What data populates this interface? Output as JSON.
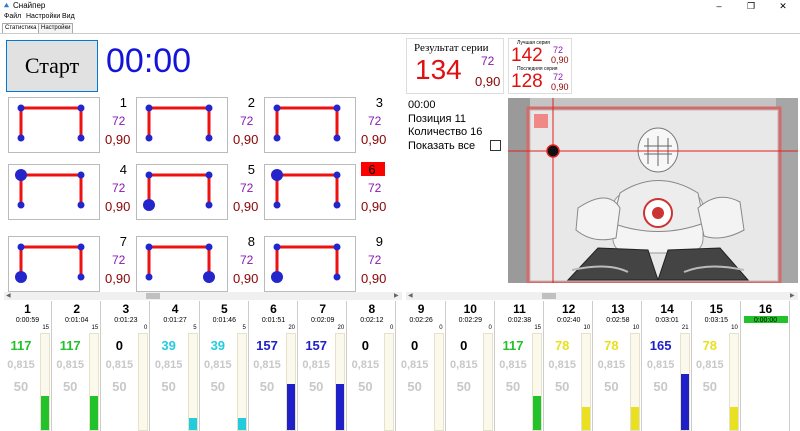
{
  "window": {
    "title": "Снайпер",
    "min": "–",
    "max": "❐",
    "close": "✕"
  },
  "menu": [
    "Файл",
    "Настройки",
    "Вид"
  ],
  "tabs": [
    "Статистика",
    "Настройки"
  ],
  "controls": {
    "start_label": "Старт",
    "timer": "00:00"
  },
  "series_result": {
    "label": "Результат серии",
    "value": "134",
    "sub1": "72",
    "sub2": "0,90"
  },
  "best_series": {
    "label": "Лучшая серия",
    "value": "142",
    "sub1": "72",
    "sub2": "0,90"
  },
  "last_series": {
    "label": "Последняя серия",
    "value": "128",
    "sub1": "72",
    "sub2": "0,90"
  },
  "positions": [
    {
      "num": "1",
      "v1": "72",
      "v2": "0,90",
      "highlight": false,
      "big": []
    },
    {
      "num": "2",
      "v1": "72",
      "v2": "0,90",
      "highlight": false,
      "big": []
    },
    {
      "num": "3",
      "v1": "72",
      "v2": "0,90",
      "highlight": false,
      "big": []
    },
    {
      "num": "4",
      "v1": "72",
      "v2": "0,90",
      "highlight": false,
      "big": [
        "tl"
      ]
    },
    {
      "num": "5",
      "v1": "72",
      "v2": "0,90",
      "highlight": false,
      "big": [
        "bl"
      ]
    },
    {
      "num": "6",
      "v1": "72",
      "v2": "0,90",
      "highlight": true,
      "big": [
        "tl"
      ]
    },
    {
      "num": "7",
      "v1": "72",
      "v2": "0,90",
      "highlight": false,
      "big": [
        "bl"
      ]
    },
    {
      "num": "8",
      "v1": "72",
      "v2": "0,90",
      "highlight": false,
      "big": [
        "br"
      ]
    },
    {
      "num": "9",
      "v1": "72",
      "v2": "0,90",
      "highlight": false,
      "big": [
        "bl"
      ]
    }
  ],
  "info": {
    "time": "00:00",
    "position_label": "Позиция",
    "position": "11",
    "count_label": "Количество",
    "count": "16",
    "show_all_label": "Показать все"
  },
  "shots": [
    {
      "num": "1",
      "time": "0:00:59",
      "count": "15",
      "value": "117",
      "color": "#22c32a",
      "fill": 0.35,
      "v2": "0,815",
      "v3": "50",
      "green": false
    },
    {
      "num": "2",
      "time": "0:01:04",
      "count": "15",
      "value": "117",
      "color": "#22c32a",
      "fill": 0.35,
      "v2": "0,815",
      "v3": "50",
      "green": false
    },
    {
      "num": "3",
      "time": "0:01:23",
      "count": "0",
      "value": "0",
      "color": "#000000",
      "fill": 0,
      "v2": "0,815",
      "v3": "50",
      "green": false
    },
    {
      "num": "4",
      "time": "0:01:27",
      "count": "5",
      "value": "39",
      "color": "#22ccdd",
      "fill": 0.12,
      "v2": "0,815",
      "v3": "50",
      "green": false
    },
    {
      "num": "5",
      "time": "0:01:46",
      "count": "5",
      "value": "39",
      "color": "#22ccdd",
      "fill": 0.12,
      "v2": "0,815",
      "v3": "50",
      "green": false
    },
    {
      "num": "6",
      "time": "0:01:51",
      "count": "20",
      "value": "157",
      "color": "#2020c8",
      "fill": 0.48,
      "v2": "0,815",
      "v3": "50",
      "green": false
    },
    {
      "num": "7",
      "time": "0:02:09",
      "count": "20",
      "value": "157",
      "color": "#2020c8",
      "fill": 0.48,
      "v2": "0,815",
      "v3": "50",
      "green": false
    },
    {
      "num": "8",
      "time": "0:02:12",
      "count": "0",
      "value": "0",
      "color": "#000000",
      "fill": 0,
      "v2": "0,815",
      "v3": "50",
      "green": false
    },
    {
      "num": "9",
      "time": "0:02:26",
      "count": "0",
      "value": "0",
      "color": "#000000",
      "fill": 0,
      "v2": "0,815",
      "v3": "50",
      "green": false
    },
    {
      "num": "10",
      "time": "0:02:29",
      "count": "0",
      "value": "0",
      "color": "#000000",
      "fill": 0,
      "v2": "0,815",
      "v3": "50",
      "green": false
    },
    {
      "num": "11",
      "time": "0:02:38",
      "count": "15",
      "value": "117",
      "color": "#22c32a",
      "fill": 0.35,
      "v2": "0,815",
      "v3": "50",
      "green": false
    },
    {
      "num": "12",
      "time": "0:02:40",
      "count": "10",
      "value": "78",
      "color": "#e8e020",
      "fill": 0.24,
      "v2": "0,815",
      "v3": "50",
      "green": false
    },
    {
      "num": "13",
      "time": "0:02:58",
      "count": "10",
      "value": "78",
      "color": "#e8e020",
      "fill": 0.24,
      "v2": "0,815",
      "v3": "50",
      "green": false
    },
    {
      "num": "14",
      "time": "0:03:01",
      "count": "21",
      "value": "165",
      "color": "#2020c8",
      "fill": 0.58,
      "v2": "0,815",
      "v3": "50",
      "green": false
    },
    {
      "num": "15",
      "time": "0:03:15",
      "count": "10",
      "value": "78",
      "color": "#e8e020",
      "fill": 0.24,
      "v2": "0,815",
      "v3": "50",
      "green": false
    },
    {
      "num": "16",
      "time": "0:00:00",
      "count": "",
      "value": "",
      "color": "#000000",
      "fill": 0,
      "v2": "",
      "v3": "",
      "green": true
    }
  ]
}
